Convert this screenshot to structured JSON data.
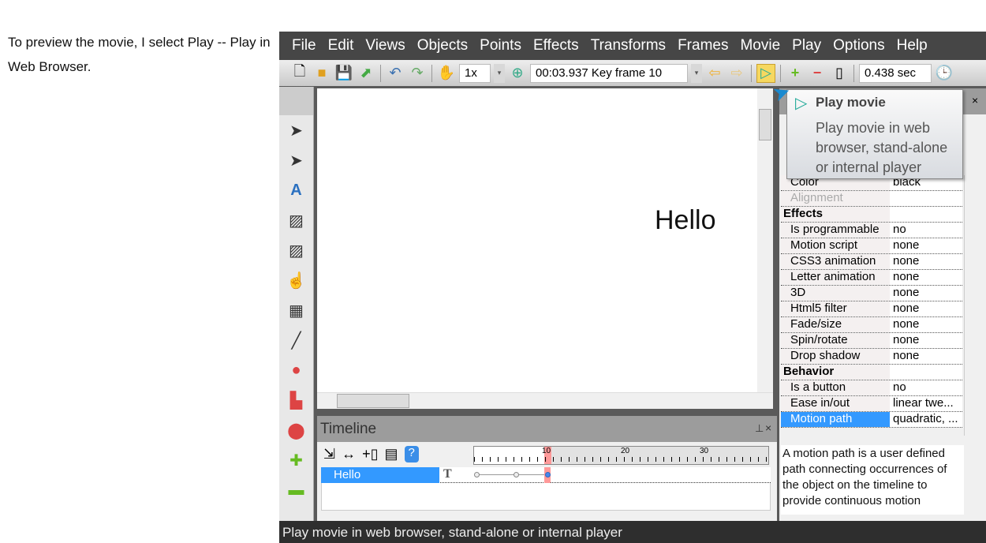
{
  "intro_text": "To preview the movie, I select Play -- Play in Web Browser.",
  "menu": [
    "File",
    "Edit",
    "Views",
    "Objects",
    "Points",
    "Effects",
    "Transforms",
    "Frames",
    "Movie",
    "Play",
    "Options",
    "Help"
  ],
  "toolbar": {
    "zoom_value": "1x",
    "frame_value": "00:03.937  Key frame 10",
    "duration_value": "0.438 sec"
  },
  "canvas": {
    "text": "Hello"
  },
  "timeline": {
    "title": "Timeline",
    "ruler_labels": [
      "10",
      "20",
      "30"
    ],
    "row_label": "Hello"
  },
  "tooltip": {
    "title": "Play movie",
    "body": "Play movie in web browser, stand-alone or internal player"
  },
  "properties": [
    {
      "k": "Color",
      "v": "black"
    },
    {
      "k": "Alignment",
      "v": "",
      "disabled": true
    },
    {
      "k": "Effects",
      "v": "",
      "section": true
    },
    {
      "k": "Is programmable",
      "v": "no"
    },
    {
      "k": "Motion script",
      "v": "none"
    },
    {
      "k": "CSS3 animation",
      "v": "none"
    },
    {
      "k": "Letter animation",
      "v": "none"
    },
    {
      "k": "3D",
      "v": "none"
    },
    {
      "k": "Html5 filter",
      "v": "none"
    },
    {
      "k": "Fade/size",
      "v": "none"
    },
    {
      "k": "Spin/rotate",
      "v": "none"
    },
    {
      "k": "Drop shadow",
      "v": "none"
    },
    {
      "k": "Behavior",
      "v": "",
      "section": true
    },
    {
      "k": "Is a button",
      "v": "no"
    },
    {
      "k": "Ease in/out",
      "v": "linear twe..."
    },
    {
      "k": "Motion path",
      "v": "quadratic, ...",
      "selected": true
    }
  ],
  "description": "A motion path is a user defined path connecting occurrences of the object on the timeline to provide continuous motion",
  "status": "Play movie in web browser, stand-alone or internal player"
}
